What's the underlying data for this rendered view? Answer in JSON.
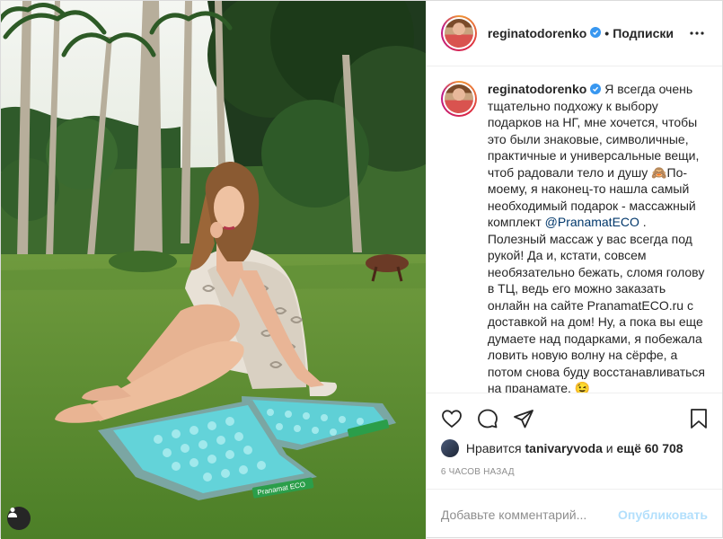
{
  "post": {
    "username": "reginatodorenko",
    "separator": "•",
    "follow_label": "Подписки",
    "more_icon": "more-horizontal-icon",
    "caption_parts": {
      "before_mention": "Я всегда очень тщательно подхожу к выбору подарков на НГ, мне хочется, чтобы это были знаковые, символичные, практичные и универсальные вещи, чтоб радовали тело и душу 🙈По-моему, я наконец-то нашла самый необходимый подарок - массажный комплект ",
      "mention": "@PranamatECO",
      "after_mention": " . Полезный массаж у вас всегда под рукой! Да и, кстати, совсем необязательно бежать, сломя голову в ТЦ, ведь его можно заказать онлайн на сайте PranamatECO.ru с доставкой на дом! Ну, а пока вы еще думаете над подарками, я побежала ловить новую волну на сёрфе, а потом снова буду восстанавливаться на пранамате. 😉"
    },
    "likes": {
      "prefix": "Нравится",
      "liker": "tanivaryvoda",
      "conjunction": "и",
      "others": "ещё 60 708"
    },
    "time_ago": "6 часов назад",
    "comment_placeholder": "Добавьте комментарий...",
    "publish_label": "Опубликовать",
    "mat_brand": "Pranamat ECO"
  },
  "colors": {
    "accent_blue": "#3897f0",
    "publish_disabled": "#b2dffc",
    "mat_turquoise": "#6cd4d8",
    "border": "#efefef"
  },
  "icons": [
    "heart-icon",
    "comment-icon",
    "share-icon",
    "bookmark-icon",
    "verified-badge-icon",
    "user-tag-icon"
  ]
}
